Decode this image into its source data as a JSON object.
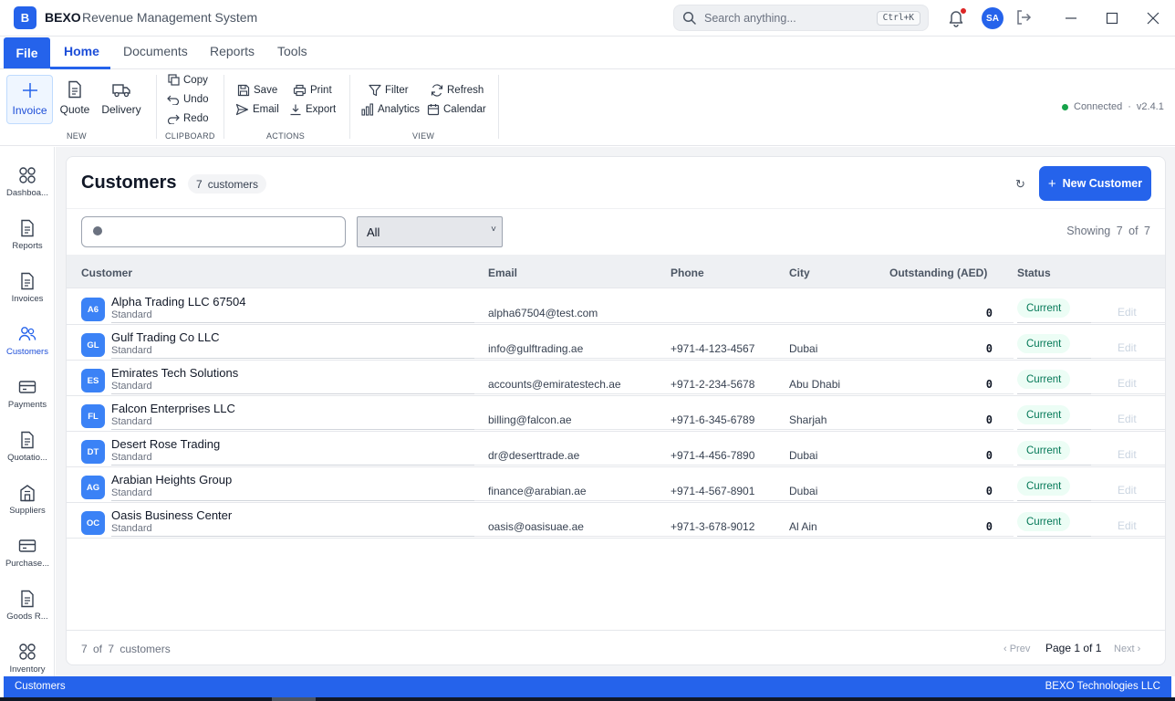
{
  "titlebar": {
    "logo_letter": "B",
    "brand": "BEXO",
    "app_name": "Revenue Management System",
    "search_placeholder": "Search anything...",
    "search_shortcut": "Ctrl+K",
    "user_initials": "SA",
    "notification_dot_color": "#dc2626"
  },
  "menu": {
    "file": "File",
    "tabs": [
      "Home",
      "Documents",
      "Reports",
      "Tools"
    ],
    "active_tab": "Home"
  },
  "ribbon": {
    "new_group": {
      "label": "NEW",
      "items": [
        {
          "label": "Invoice",
          "icon": "plus-icon",
          "selected": true
        },
        {
          "label": "Quote",
          "icon": "document-icon"
        },
        {
          "label": "Delivery",
          "icon": "truck-icon"
        }
      ]
    },
    "clipboard_group": {
      "label": "CLIPBOARD",
      "items": [
        {
          "label": "Copy",
          "icon": "copy-icon"
        },
        {
          "label": "Undo",
          "icon": "undo-icon"
        },
        {
          "label": "Redo",
          "icon": "redo-icon"
        }
      ]
    },
    "actions_group": {
      "label": "ACTIONS",
      "items": [
        {
          "label": "Save",
          "icon": "save-icon"
        },
        {
          "label": "Print",
          "icon": "print-icon"
        },
        {
          "label": "Email",
          "icon": "send-icon"
        },
        {
          "label": "Export",
          "icon": "export-icon"
        }
      ]
    },
    "view_group": {
      "label": "VIEW",
      "items": [
        {
          "label": "Filter",
          "icon": "filter-icon"
        },
        {
          "label": "Refresh",
          "icon": "refresh-icon"
        },
        {
          "label": "Analytics",
          "icon": "bar-chart-icon"
        },
        {
          "label": "Calendar",
          "icon": "calendar-icon"
        }
      ]
    },
    "connection": {
      "status": "Connected",
      "separator": "·",
      "version": "v2.4.1",
      "status_color": "#16a34a"
    }
  },
  "sidebar": {
    "items": [
      {
        "label": "Dashboa...",
        "icon": "grid-icon"
      },
      {
        "label": "Reports",
        "icon": "document-icon"
      },
      {
        "label": "Invoices",
        "icon": "document-icon"
      },
      {
        "label": "Customers",
        "icon": "users-icon",
        "active": true
      },
      {
        "label": "Payments",
        "icon": "card-icon"
      },
      {
        "label": "Quotatio...",
        "icon": "document-icon"
      },
      {
        "label": "Suppliers",
        "icon": "building-icon"
      },
      {
        "label": "Purchase...",
        "icon": "card-icon"
      },
      {
        "label": "Goods R...",
        "icon": "document-icon"
      },
      {
        "label": "Inventory",
        "icon": "grid-icon"
      }
    ]
  },
  "page": {
    "title": "Customers",
    "count_number": "7",
    "count_word": "customers",
    "refresh_glyph": "↻",
    "new_button": "New Customer",
    "filter_value": "",
    "status_filter": "All",
    "showing": "Showing 7 of 7"
  },
  "table": {
    "columns": [
      "Customer",
      "Email",
      "Phone",
      "City",
      "Outstanding (AED)",
      "Status"
    ],
    "edit_label": "Edit",
    "rows": [
      {
        "initials": "A6",
        "name": "Alpha Trading LLC 67504",
        "tier": "Standard",
        "email": "alpha67504@test.com",
        "phone": "",
        "city": "",
        "outstanding": "0",
        "status": "Current"
      },
      {
        "initials": "GL",
        "name": "Gulf Trading Co LLC",
        "tier": "Standard",
        "email": "info@gulftrading.ae",
        "phone": "+971-4-123-4567",
        "city": "Dubai",
        "outstanding": "0",
        "status": "Current"
      },
      {
        "initials": "ES",
        "name": "Emirates Tech Solutions",
        "tier": "Standard",
        "email": "accounts@emiratestech.ae",
        "phone": "+971-2-234-5678",
        "city": "Abu Dhabi",
        "outstanding": "0",
        "status": "Current"
      },
      {
        "initials": "FL",
        "name": "Falcon Enterprises LLC",
        "tier": "Standard",
        "email": "billing@falcon.ae",
        "phone": "+971-6-345-6789",
        "city": "Sharjah",
        "outstanding": "0",
        "status": "Current"
      },
      {
        "initials": "DT",
        "name": "Desert Rose Trading",
        "tier": "Standard",
        "email": "dr@deserttrade.ae",
        "phone": "+971-4-456-7890",
        "city": "Dubai",
        "outstanding": "0",
        "status": "Current"
      },
      {
        "initials": "AG",
        "name": "Arabian Heights Group",
        "tier": "Standard",
        "email": "finance@arabian.ae",
        "phone": "+971-4-567-8901",
        "city": "Dubai",
        "outstanding": "0",
        "status": "Current"
      },
      {
        "initials": "OC",
        "name": "Oasis Business Center",
        "tier": "Standard",
        "email": "oasis@oasisuae.ae",
        "phone": "+971-3-678-9012",
        "city": "Al Ain",
        "outstanding": "0",
        "status": "Current"
      }
    ]
  },
  "footer": {
    "summary": "7 of 7 customers",
    "prev": "‹ Prev",
    "page": "Page 1 of 1",
    "next": "Next ›"
  },
  "statusbar": {
    "left": "Customers",
    "right": "BEXO Technologies LLC"
  },
  "colors": {
    "accent": "#2563eb",
    "status_current_bg": "#ecfdf5",
    "status_current_text": "#047857"
  }
}
